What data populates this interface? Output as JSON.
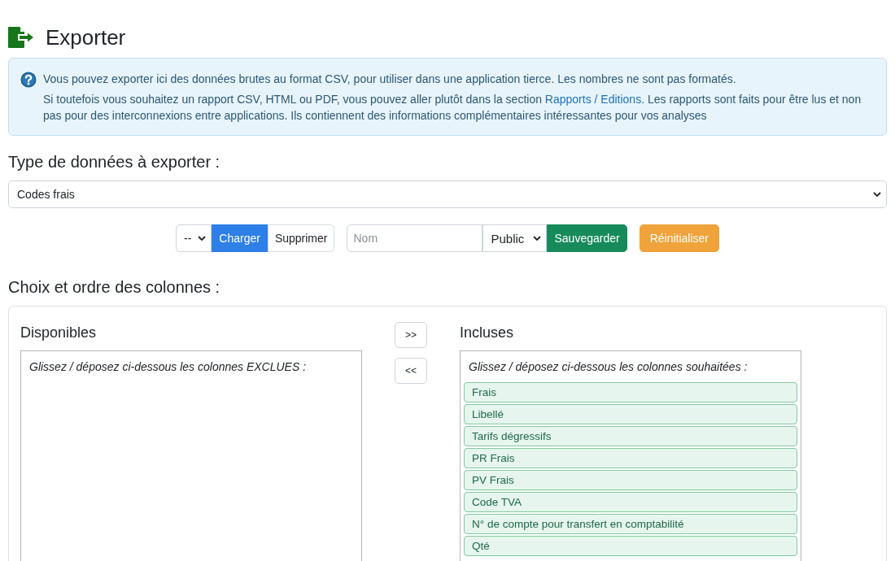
{
  "page": {
    "title": "Exporter"
  },
  "info": {
    "lines": [
      {
        "text": "Vous pouvez exporter ici des données brutes au format CSV, pour utiliser dans une application tierce. Les nombres ne sont pas formatés."
      },
      {
        "text": "Si toutefois vous souhaitez un rapport CSV, HTML ou PDF, vous pouvez aller plutôt dans la section ",
        "link": "Rapports / Editions",
        "after": ". Les rapports sont faits pour être lus et non pas pour des interconnexions entre applications. Ils contiennent des informations complémentaires intéressantes pour vos analyses"
      }
    ]
  },
  "data_type": {
    "heading": "Type de données à exporter :",
    "value": "Codes frais"
  },
  "toolbar": {
    "groups": [
      {
        "controls": [
          {
            "kind": "select",
            "value": "--"
          },
          {
            "kind": "button",
            "label": "Charger"
          },
          {
            "kind": "button",
            "label": "Supprimer"
          }
        ]
      },
      {
        "controls": [
          {
            "kind": "input",
            "placeholder": "Nom"
          },
          {
            "kind": "select",
            "value": "Public"
          },
          {
            "kind": "button",
            "label": "Sauvegarder"
          }
        ]
      },
      {
        "controls": [
          {
            "kind": "button",
            "label": "Réinitialiser"
          }
        ]
      }
    ]
  },
  "columns": {
    "heading": "Choix et ordre des colonnes :",
    "available": {
      "title": "Disponibles",
      "hint": "Glissez / déposez ci-dessous les colonnes EXCLUES :"
    },
    "move_buttons": [
      ">>",
      "<<"
    ],
    "included": {
      "title": "Incluses",
      "hint": "Glissez / déposez ci-dessous les colonnes souhaitées :",
      "items": [
        "Frais",
        "Libellé",
        "Tarifs dégressifs",
        "PR Frais",
        "PV Frais",
        "Code TVA",
        "N° de compte pour transfert en comptabilité",
        "Qté"
      ]
    }
  }
}
